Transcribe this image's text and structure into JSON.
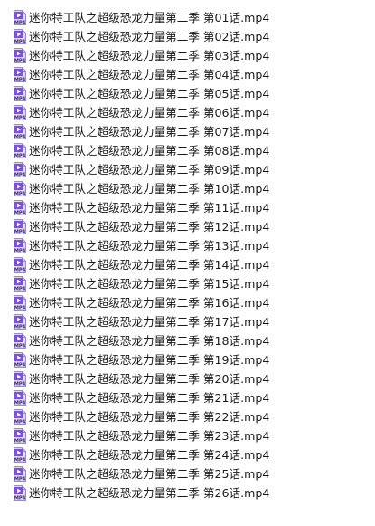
{
  "file_type_icon": "mp4-video-file-icon",
  "icon_colors": {
    "badge": "#7b52d6",
    "badge_dark": "#4a2fa0",
    "page": "#dcd6ef",
    "label": "#3b2a7a"
  },
  "icon_label": "MP4",
  "files": [
    {
      "name": "迷你特工队之超级恐龙力量第二季 第01话.mp4"
    },
    {
      "name": "迷你特工队之超级恐龙力量第二季 第02话.mp4"
    },
    {
      "name": "迷你特工队之超级恐龙力量第二季 第03话.mp4"
    },
    {
      "name": "迷你特工队之超级恐龙力量第二季 第04话.mp4"
    },
    {
      "name": "迷你特工队之超级恐龙力量第二季 第05话.mp4"
    },
    {
      "name": "迷你特工队之超级恐龙力量第二季 第06话.mp4"
    },
    {
      "name": "迷你特工队之超级恐龙力量第二季 第07话.mp4"
    },
    {
      "name": "迷你特工队之超级恐龙力量第二季 第08话.mp4"
    },
    {
      "name": "迷你特工队之超级恐龙力量第二季 第09话.mp4"
    },
    {
      "name": "迷你特工队之超级恐龙力量第二季 第10话.mp4"
    },
    {
      "name": "迷你特工队之超级恐龙力量第二季 第11话.mp4"
    },
    {
      "name": "迷你特工队之超级恐龙力量第二季 第12话.mp4"
    },
    {
      "name": "迷你特工队之超级恐龙力量第二季 第13话.mp4"
    },
    {
      "name": "迷你特工队之超级恐龙力量第二季 第14话.mp4"
    },
    {
      "name": "迷你特工队之超级恐龙力量第二季 第15话.mp4"
    },
    {
      "name": "迷你特工队之超级恐龙力量第二季 第16话.mp4"
    },
    {
      "name": "迷你特工队之超级恐龙力量第二季 第17话.mp4"
    },
    {
      "name": "迷你特工队之超级恐龙力量第二季 第18话.mp4"
    },
    {
      "name": "迷你特工队之超级恐龙力量第二季 第19话.mp4"
    },
    {
      "name": "迷你特工队之超级恐龙力量第二季 第20话.mp4"
    },
    {
      "name": "迷你特工队之超级恐龙力量第二季 第21话.mp4"
    },
    {
      "name": "迷你特工队之超级恐龙力量第二季 第22话.mp4"
    },
    {
      "name": "迷你特工队之超级恐龙力量第二季 第23话.mp4"
    },
    {
      "name": "迷你特工队之超级恐龙力量第二季 第24话.mp4"
    },
    {
      "name": "迷你特工队之超级恐龙力量第二季 第25话.mp4"
    },
    {
      "name": "迷你特工队之超级恐龙力量第二季 第26话.mp4"
    }
  ]
}
